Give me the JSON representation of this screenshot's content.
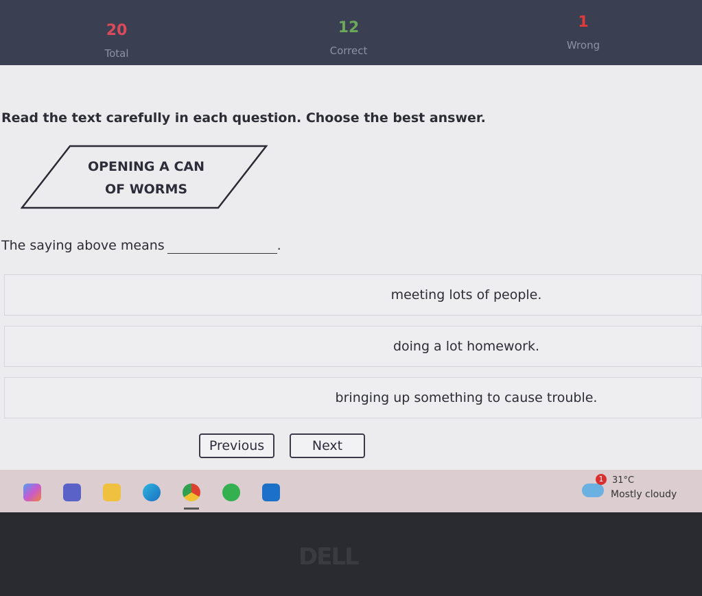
{
  "score": {
    "total": {
      "value": "20",
      "label": "Total",
      "color": "#d94a5a"
    },
    "correct": {
      "value": "12",
      "label": "Correct",
      "color": "#6aa85a"
    },
    "wrong": {
      "value": "1",
      "label": "Wrong",
      "color": "#e03a3a"
    }
  },
  "question": {
    "instruction": "Read the text carefully in each question. Choose the best answer.",
    "saying_line1": "OPENING A CAN",
    "saying_line2": "OF WORMS",
    "prompt": "The saying above means",
    "prompt_end": ".",
    "options": [
      "meeting lots of people.",
      "doing a lot homework.",
      "bringing up something to cause trouble."
    ]
  },
  "nav": {
    "previous": "Previous",
    "next": "Next"
  },
  "taskbar": {
    "apps": [
      "copilot-icon",
      "teams-icon",
      "file-explorer-icon",
      "edge-icon",
      "chrome-icon",
      "whatsapp-icon",
      "outlook-icon"
    ],
    "weather": {
      "temp": "31°C",
      "condition": "Mostly cloudy",
      "badge": "1"
    }
  },
  "bezel": {
    "logo": "DELL"
  }
}
